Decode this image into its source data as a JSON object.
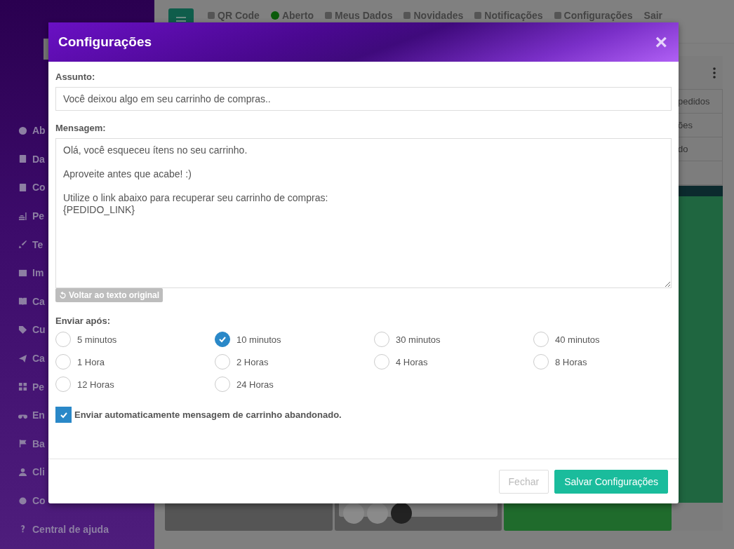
{
  "sidebar": {
    "items": [
      {
        "label": "Ab"
      },
      {
        "label": "Da"
      },
      {
        "label": "Co"
      },
      {
        "label": "Pe"
      },
      {
        "label": "Te"
      },
      {
        "label": "Im"
      },
      {
        "label": "Ca"
      },
      {
        "label": "Cu"
      },
      {
        "label": "Ca"
      },
      {
        "label": "Pe"
      },
      {
        "label": "En"
      },
      {
        "label": "Ba"
      },
      {
        "label": "Cli"
      },
      {
        "label": "Co"
      },
      {
        "label": "Central de ajuda"
      }
    ]
  },
  "topbar": {
    "items": [
      {
        "label": "QR Code"
      },
      {
        "label": "Aberto"
      },
      {
        "label": "Meus Dados"
      },
      {
        "label": "Novidades"
      },
      {
        "label": "Notificações"
      },
      {
        "label": "Configurações"
      },
      {
        "label": "Sair"
      }
    ]
  },
  "background_menu": {
    "items": [
      "pedidos",
      "ões",
      "do"
    ]
  },
  "modal": {
    "title": "Configurações",
    "close": "×",
    "subject": {
      "label": "Assunto:",
      "value": "Você deixou algo em seu carrinho de compras.."
    },
    "message": {
      "label": "Mensagem:",
      "value": "Olá, você esqueceu ítens no seu carrinho.\n\nAproveite antes que acabe! :)\n\nUtilize o link abaixo para recuperar seu carrinho de compras:\n{PEDIDO_LINK}"
    },
    "reset_button": "Voltar ao texto original",
    "send_after": {
      "label": "Enviar após:",
      "options": [
        {
          "label": "5 minutos",
          "selected": false
        },
        {
          "label": "10 minutos",
          "selected": true
        },
        {
          "label": "30 minutos",
          "selected": false
        },
        {
          "label": "40 minutos",
          "selected": false
        },
        {
          "label": "1 Hora",
          "selected": false
        },
        {
          "label": "2 Horas",
          "selected": false
        },
        {
          "label": "4 Horas",
          "selected": false
        },
        {
          "label": "8 Horas",
          "selected": false
        },
        {
          "label": "12 Horas",
          "selected": false
        },
        {
          "label": "24 Horas",
          "selected": false
        }
      ]
    },
    "auto_send": {
      "label": "Enviar automaticamente mensagem de carrinho abandonado.",
      "checked": true
    },
    "buttons": [
      {
        "label": "Fechar",
        "disabled": true
      },
      {
        "label": "Salvar Configurações",
        "disabled": false
      }
    ]
  }
}
